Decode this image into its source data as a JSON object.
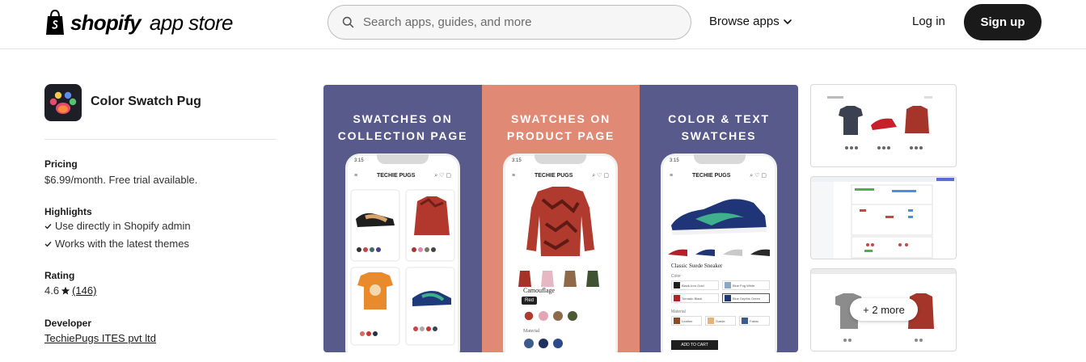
{
  "header": {
    "logo_brand": "shopify",
    "logo_suffix": "app store",
    "search_placeholder": "Search apps, guides, and more",
    "browse_label": "Browse apps",
    "login_label": "Log in",
    "signup_label": "Sign up"
  },
  "app": {
    "name": "Color Swatch Pug",
    "pricing_label": "Pricing",
    "pricing_value": "$6.99/month. Free trial available.",
    "highlights_label": "Highlights",
    "highlights": [
      "Use directly in Shopify admin",
      "Works with the latest themes"
    ],
    "rating_label": "Rating",
    "rating_value": "4.6",
    "rating_count": "(146)",
    "developer_label": "Developer",
    "developer_name": "TechiePugs ITES pvt ltd"
  },
  "hero": {
    "panels": [
      {
        "title_line1": "SWATCHES ON",
        "title_line2": "COLLECTION PAGE",
        "bg": "#575a8a"
      },
      {
        "title_line1": "SWATCHES ON",
        "title_line2": "PRODUCT PAGE",
        "bg": "#e08a76"
      },
      {
        "title_line1": "COLOR & TEXT",
        "title_line2": "SWATCHES",
        "bg": "#575a8a"
      }
    ],
    "phone_time": "3:15",
    "phone_brand": "TECHIE PUGS",
    "product_label": "Camouflage",
    "selected_swatch": "Red",
    "material_label": "Material",
    "shoe_title": "Classic Suede Sneaker",
    "color_label": "Color",
    "color_options": [
      "Black-Iron Gold",
      "Blue Fog White",
      "Tornado Black",
      "Blue Depths Green"
    ],
    "material_options": [
      "Leather",
      "Suede",
      "Fabric"
    ],
    "add_to_cart": "ADD TO CART"
  },
  "thumbnails": {
    "more_label": "+ 2 more"
  },
  "colors": {
    "panel_purple": "#575a8a",
    "panel_coral": "#e08a76",
    "signup_bg": "#1a1a1a"
  }
}
